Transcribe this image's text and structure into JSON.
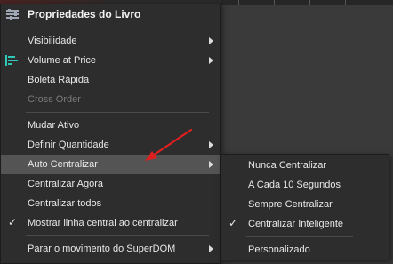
{
  "menu": {
    "title": "Propriedades do Livro",
    "items": [
      {
        "label": "Visibilidade",
        "submenu": true
      },
      {
        "label": "Volume at Price",
        "submenu": true
      },
      {
        "label": "Boleta Rápida"
      },
      {
        "label": "Cross Order",
        "disabled": true
      },
      {
        "label": "Mudar Ativo"
      },
      {
        "label": "Definir Quantidade",
        "submenu": true
      },
      {
        "label": "Auto Centralizar",
        "submenu": true,
        "highlighted": true
      },
      {
        "label": "Centralizar Agora"
      },
      {
        "label": "Centralizar todos"
      },
      {
        "label": "Mostrar linha central ao centralizar",
        "checked": true
      },
      {
        "label": "Parar o movimento do SuperDOM",
        "submenu": true
      }
    ]
  },
  "submenu": {
    "items": [
      {
        "label": "Nunca Centralizar"
      },
      {
        "label": "A Cada 10 Segundos"
      },
      {
        "label": "Sempre Centralizar"
      },
      {
        "label": "Centralizar Inteligente",
        "checked": true
      },
      {
        "label": "Personalizado"
      }
    ]
  },
  "icons": {
    "title_icon": "sliders-icon",
    "volume_icon": "volume-bars-icon",
    "check_glyph": "✓"
  },
  "colors": {
    "menu_bg": "#2d2d2d",
    "highlight": "#545454",
    "volume_icon": "#2fc7b5",
    "annotation_arrow": "#e02020"
  }
}
